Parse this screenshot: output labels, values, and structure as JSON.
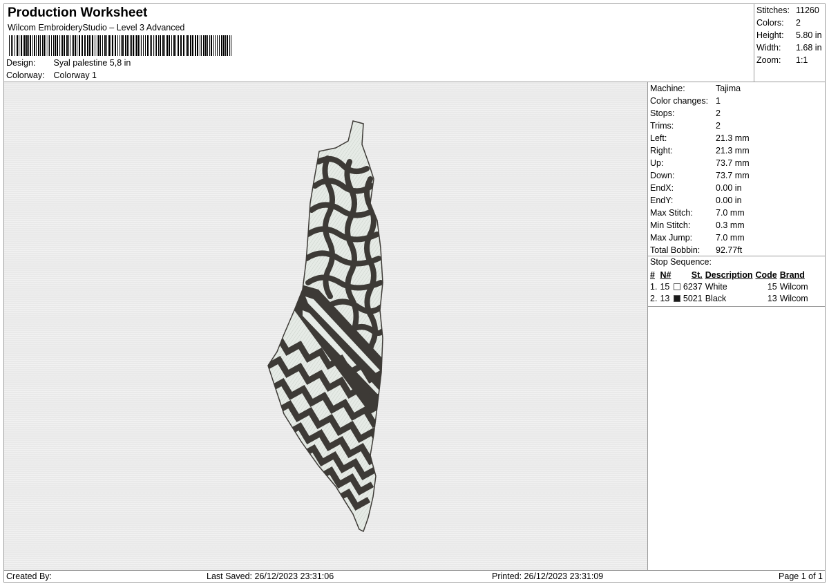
{
  "header": {
    "title": "Production Worksheet",
    "subtitle": "Wilcom EmbroideryStudio – Level 3 Advanced",
    "design_label": "Design:",
    "design_value": "Syal palestine 5,8 in",
    "colorway_label": "Colorway:",
    "colorway_value": "Colorway 1"
  },
  "stats": [
    {
      "label": "Stitches:",
      "value": "11260"
    },
    {
      "label": "Colors:",
      "value": "2"
    },
    {
      "label": "Height:",
      "value": "5.80 in"
    },
    {
      "label": "Width:",
      "value": "1.68 in"
    },
    {
      "label": "Zoom:",
      "value": "1:1"
    }
  ],
  "machine": [
    {
      "label": "Machine:",
      "value": "Tajima"
    },
    {
      "label": "Color changes:",
      "value": "1"
    },
    {
      "label": "Stops:",
      "value": "2"
    },
    {
      "label": "Trims:",
      "value": "2"
    },
    {
      "label": "Left:",
      "value": "21.3 mm"
    },
    {
      "label": "Right:",
      "value": "21.3 mm"
    },
    {
      "label": "Up:",
      "value": "73.7 mm"
    },
    {
      "label": "Down:",
      "value": "73.7 mm"
    },
    {
      "label": "EndX:",
      "value": "0.00 in"
    },
    {
      "label": "EndY:",
      "value": "0.00 in"
    },
    {
      "label": "Max Stitch:",
      "value": "7.0 mm"
    },
    {
      "label": "Min Stitch:",
      "value": "0.3 mm"
    },
    {
      "label": "Max Jump:",
      "value": "7.0 mm"
    },
    {
      "label": "Total Bobbin:",
      "value": "92.77ft"
    }
  ],
  "stop_sequence": {
    "title": "Stop Sequence:",
    "columns": [
      "#",
      "N#",
      "St.",
      "Description",
      "Code",
      "Brand"
    ],
    "rows": [
      {
        "idx": "1.",
        "n": "15",
        "swatch": "#ffffff",
        "st": "6237",
        "desc": "White",
        "code": "15",
        "brand": "Wilcom"
      },
      {
        "idx": "2.",
        "n": "13",
        "swatch": "#1a1a1a",
        "st": "5021",
        "desc": "Black",
        "code": "13",
        "brand": "Wilcom"
      }
    ]
  },
  "footer": {
    "created_by": "Created By:",
    "last_saved": "Last Saved: 26/12/2023 23:31:06",
    "printed": "Printed: 26/12/2023 23:31:09",
    "page": "Page 1 of 1"
  },
  "colors": {
    "thread_dark": "#3d3a36",
    "thread_light": "#e8ece8",
    "background": "#e9e9e9"
  }
}
